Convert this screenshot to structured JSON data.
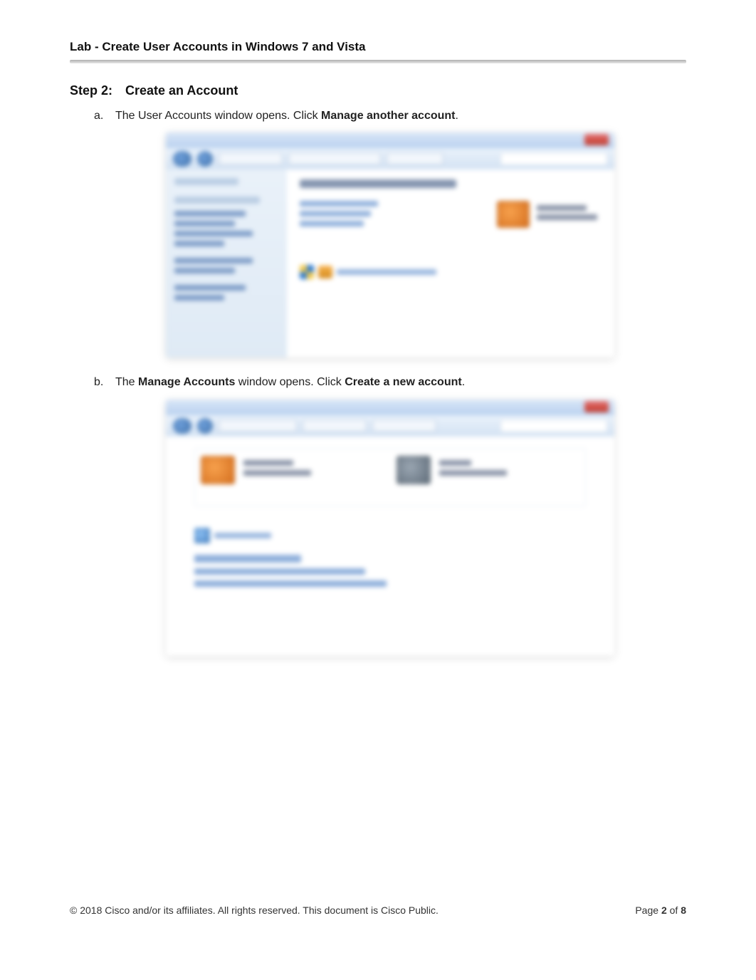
{
  "header": {
    "title": "Lab - Create User Accounts in Windows 7 and Vista"
  },
  "step": {
    "label": "Step 2:",
    "title": "Create an Account"
  },
  "items": {
    "a": {
      "marker": "a.",
      "text_before": "The User Accounts window opens. Click ",
      "bold": "Manage another account",
      "text_after": "."
    },
    "b": {
      "marker": "b.",
      "text_before": "The ",
      "bold1": "Manage Accounts",
      "text_mid": " window opens. Click ",
      "bold2": "Create a new account",
      "text_after": "."
    }
  },
  "footer": {
    "copyright": "© 2018 Cisco and/or its affiliates. All rights reserved. This document is Cisco Public.",
    "page_label": "Page ",
    "page_num": "2",
    "of": " of ",
    "total": "8"
  }
}
